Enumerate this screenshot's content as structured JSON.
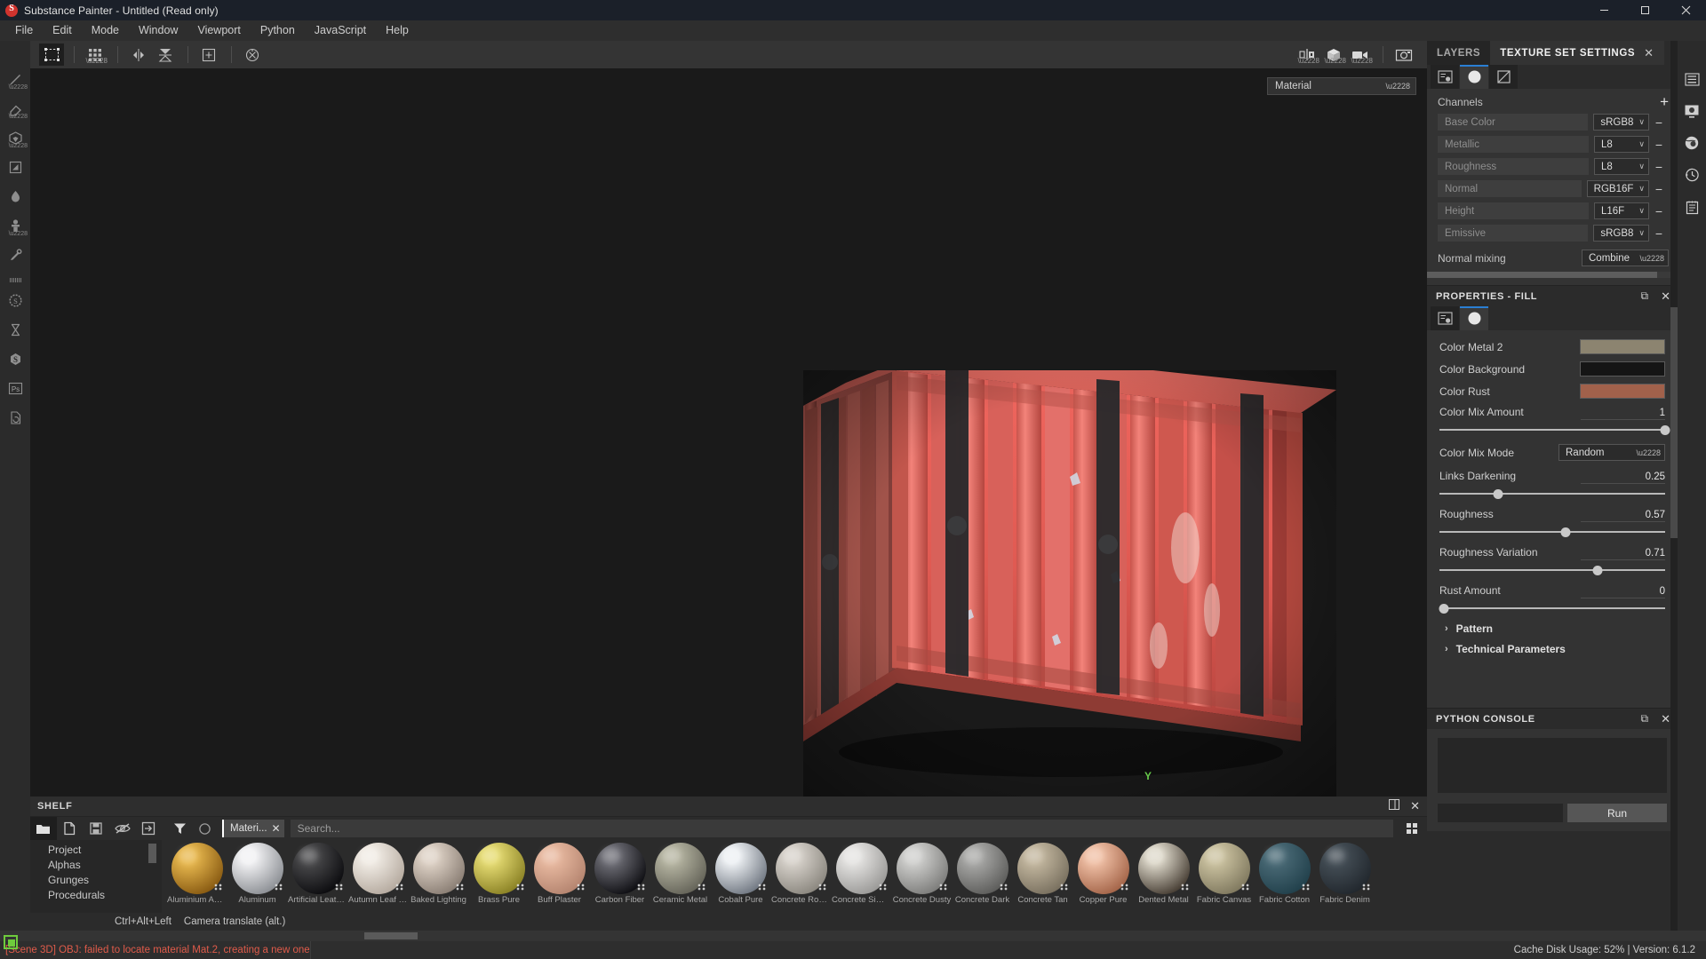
{
  "titlebar": {
    "title": "Substance Painter - Untitled (Read only)",
    "minimize": "─",
    "maximize": "❐",
    "close": "✕"
  },
  "menubar": {
    "items": [
      "File",
      "Edit",
      "Mode",
      "Window",
      "Viewport",
      "Python",
      "JavaScript",
      "Help"
    ]
  },
  "left_toolbar": {
    "items": [
      {
        "name": "paint-brush-icon"
      },
      {
        "name": "eraser-icon"
      },
      {
        "name": "projection-icon"
      },
      {
        "name": "polygon-fill-icon"
      },
      {
        "name": "smudge-icon"
      },
      {
        "name": "clone-stamp-icon"
      },
      {
        "name": "eyedropper-icon"
      },
      {
        "name": "separator"
      },
      {
        "name": "substance-badge-icon"
      },
      {
        "name": "hourglass-icon"
      },
      {
        "name": "substance-source-icon"
      },
      {
        "name": "photoshop-icon",
        "label": "Ps"
      },
      {
        "name": "refresh-document-icon"
      }
    ]
  },
  "top_toolbar": {
    "left_items": [
      {
        "name": "selection-tool-icon",
        "active": true
      },
      {
        "name": "uv-grid-icon",
        "active": false
      },
      {
        "name": "symmetry-icon",
        "active": false
      },
      {
        "name": "symmetry-plane-icon",
        "active": false
      },
      {
        "name": "add-pivot-icon",
        "active": false
      },
      {
        "name": "reset-rotation-icon",
        "active": false
      }
    ],
    "right_items": [
      {
        "name": "material-view-toggle-icon"
      },
      {
        "name": "cube-view-icon"
      },
      {
        "name": "camera-icon"
      },
      {
        "name": "screenshot-icon"
      }
    ]
  },
  "viewport": {
    "shader_select": "Material",
    "axis_label": "Y"
  },
  "shelf": {
    "title": "SHELF",
    "header_actions": [
      {
        "name": "grid-layout-icon"
      },
      {
        "name": "close-icon",
        "label": "✕"
      }
    ],
    "tools": [
      {
        "name": "open-folder-icon",
        "active": true
      },
      {
        "name": "new-document-icon",
        "active": false
      },
      {
        "name": "save-icon",
        "active": false
      },
      {
        "name": "hide-icon",
        "active": false
      },
      {
        "name": "import-icon",
        "active": false
      }
    ],
    "tree": [
      "Project",
      "Alphas",
      "Grunges",
      "Procedurals"
    ],
    "filter_icons": [
      {
        "name": "filter-funnel-icon"
      },
      {
        "name": "circle-filter-icon"
      }
    ],
    "chip": "Materi...",
    "chip_close": "✕",
    "search_placeholder": "Search...",
    "assets": [
      {
        "name": "Aluminium Anodized",
        "color1": "#e8b84e",
        "color2": "#8a5c13"
      },
      {
        "name": "Aluminum",
        "color1": "#f2f2f4",
        "color2": "#8e9196"
      },
      {
        "name": "Artificial Leather",
        "color1": "#4a4a4c",
        "color2": "#0d0d10"
      },
      {
        "name": "Autumn Leaf Diffuse",
        "color1": "#f1ece5",
        "color2": "#b6aba0"
      },
      {
        "name": "Baked Lighting",
        "color1": "#ded2c6",
        "color2": "#8b7f75"
      },
      {
        "name": "Brass Pure",
        "color1": "#e6dc73",
        "color2": "#8c8326"
      },
      {
        "name": "Buff Plaster",
        "color1": "#e8b9a0",
        "color2": "#b58570"
      },
      {
        "name": "Carbon Fiber",
        "color1": "#6f6f77",
        "color2": "#101014"
      },
      {
        "name": "Ceramic Metal",
        "color1": "#b6b5a2",
        "color2": "#66655a"
      },
      {
        "name": "Cobalt Pure",
        "color1": "#eef1f4",
        "color2": "#737a84"
      },
      {
        "name": "Concrete Rough",
        "color1": "#d7d2cb",
        "color2": "#8c8880"
      },
      {
        "name": "Concrete Simple",
        "color1": "#e5e4e2",
        "color2": "#9b9a98"
      },
      {
        "name": "Concrete Dusty",
        "color1": "#cfcfcd",
        "color2": "#7e7e7c"
      },
      {
        "name": "Concrete Dark",
        "color1": "#a9a9a7",
        "color2": "#5e5e5c"
      },
      {
        "name": "Concrete Tan",
        "color1": "#c3b79f",
        "color2": "#7a7160"
      },
      {
        "name": "Copper Pure",
        "color1": "#f0c0a6",
        "color2": "#a5664a"
      },
      {
        "name": "Dented Metal",
        "color1": "#ded9cb",
        "color2": "#4a4137"
      },
      {
        "name": "Fabric Canvas",
        "color1": "#cbc2a0",
        "color2": "#817a60"
      },
      {
        "name": "Fabric Cotton",
        "color1": "#4a6a76",
        "color2": "#22414c"
      },
      {
        "name": "Fabric Denim",
        "color1": "#454f57",
        "color2": "#22282e"
      }
    ],
    "grid_toggle_icon": "grid-view-icon"
  },
  "texture_set_settings": {
    "tabs": [
      {
        "label": "LAYERS",
        "active": false
      },
      {
        "label": "TEXTURE SET SETTINGS",
        "active": true
      }
    ],
    "tab_close": "✕",
    "sub_tabs": [
      {
        "name": "properties-list-icon",
        "active": false
      },
      {
        "name": "material-sphere-icon",
        "active": true
      },
      {
        "name": "mask-icon",
        "active": false
      }
    ],
    "channels_label": "Channels",
    "add_label": "+",
    "remove_label": "−",
    "channels": [
      {
        "name": "Base Color",
        "format": "sRGB8"
      },
      {
        "name": "Metallic",
        "format": "L8"
      },
      {
        "name": "Roughness",
        "format": "L8"
      },
      {
        "name": "Normal",
        "format": "RGB16F"
      },
      {
        "name": "Height",
        "format": "L16F"
      },
      {
        "name": "Emissive",
        "format": "sRGB8"
      }
    ],
    "normal_mixing_label": "Normal mixing",
    "normal_mixing_value": "Combine"
  },
  "properties_fill": {
    "title": "PROPERTIES - FILL",
    "float_icon": "⧉",
    "close_icon": "✕",
    "sub_tabs": [
      {
        "name": "properties-list-icon",
        "active": false
      },
      {
        "name": "material-sphere-icon",
        "active": true
      }
    ],
    "color_rows": [
      {
        "label": "Color Metal 2",
        "color": "#8c8470"
      },
      {
        "label": "Color Background",
        "color": "#151515"
      },
      {
        "label": "Color Rust",
        "color": "#a1614b"
      }
    ],
    "sliders": [
      {
        "label": "Color Mix Amount",
        "value": "1",
        "pct": 100
      },
      {
        "label": "Links Darkening",
        "value": "0.25",
        "pct": 26
      },
      {
        "label": "Roughness",
        "value": "0.57",
        "pct": 56
      },
      {
        "label": "Roughness Variation",
        "value": "0.71",
        "pct": 70
      },
      {
        "label": "Rust Amount",
        "value": "0",
        "pct": 2
      }
    ],
    "mix_mode_label": "Color Mix Mode",
    "mix_mode_value": "Random",
    "groups": [
      {
        "label": "Pattern",
        "chevron": "›"
      },
      {
        "label": "Technical Parameters",
        "chevron": "›"
      }
    ]
  },
  "python_console": {
    "title": "PYTHON CONSOLE",
    "float_icon": "⧉",
    "close_icon": "✕",
    "output": "",
    "input_value": "",
    "run_label": "Run"
  },
  "far_right_toolbar": {
    "items": [
      {
        "name": "layers-list-icon"
      },
      {
        "name": "display-settings-icon"
      },
      {
        "name": "environment-settings-icon"
      },
      {
        "name": "history-icon"
      },
      {
        "name": "notepad-icon"
      }
    ]
  },
  "hint_bar": {
    "shortcut": "Ctrl+Alt+Left",
    "action": "Camera translate (alt.)"
  },
  "statusbar": {
    "log_message": "[Scene 3D] OBJ: failed to locate material Mat.2, creating a new one",
    "cache_info": "Cache Disk Usage:   52% | Version: 6.1.2"
  },
  "colors": {
    "accent": "#2a7fd4",
    "error": "#e05b4a",
    "panel_bg": "#333333",
    "dock_bg": "#2b2b2b",
    "viewport_bg": "#1a1a1a"
  }
}
